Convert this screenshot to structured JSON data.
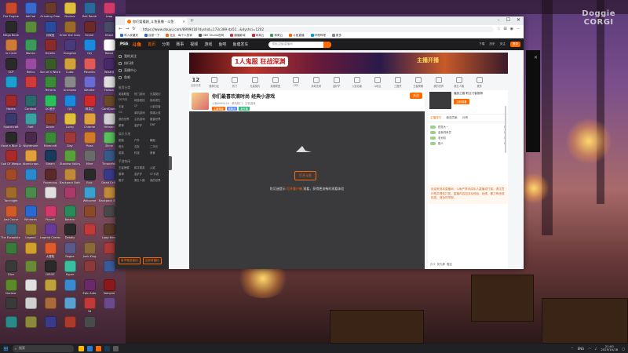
{
  "desktop": {
    "watermark": [
      "Doggie",
      "CORGI"
    ],
    "icons": [
      {
        "label": "Fire Engine",
        "color": "#c84a2a"
      },
      {
        "label": "AdiCad",
        "color": "#3a6ad0"
      },
      {
        "label": "Grinding Gear",
        "color": "#6a3a2a"
      },
      {
        "label": "Duckov",
        "color": "#e0c03a"
      },
      {
        "label": "Rail Route",
        "color": "#2a6a9a"
      },
      {
        "label": "Leap",
        "color": "#d03a6a"
      },
      {
        "label": "Mega Bonk",
        "color": "#2a2a2a"
      },
      {
        "label": "",
        "color": "#5a8a3a"
      },
      {
        "label": "对局宝",
        "color": "#2a4a9a"
      },
      {
        "label": "Enter the Gungeon",
        "color": "#9a6a2a"
      },
      {
        "label": "Sinner",
        "color": "#6a2a2a"
      },
      {
        "label": "Ghost",
        "color": "#4a4a6a"
      },
      {
        "label": "In Circle",
        "color": "#d07a3a"
      },
      {
        "label": "Worms",
        "color": "#3a9a5a"
      },
      {
        "label": "Heretic",
        "color": "#8a2a2a"
      },
      {
        "label": "Dungeon",
        "color": "#4a3a7a"
      },
      {
        "label": "QQ",
        "color": "#1a8ae0"
      },
      {
        "label": "Robot",
        "color": "#ffffff"
      },
      {
        "label": "SCP",
        "color": "#2a2a2a"
      },
      {
        "label": "Relics",
        "color": "#9a4aa0"
      },
      {
        "label": "Son of a Witch",
        "color": "#3a5a2a"
      },
      {
        "label": "Cubic",
        "color": "#d0a03a"
      },
      {
        "label": "Pikuniku",
        "color": "#e05a5a"
      },
      {
        "label": "Wizard",
        "color": "#4a2a6a"
      },
      {
        "label": "",
        "color": "#1aa0d0"
      },
      {
        "label": "",
        "color": "#d03a3a"
      },
      {
        "label": "Terraria",
        "color": "#3a8a3a"
      },
      {
        "label": "Unknown",
        "color": "#888888"
      },
      {
        "label": "Wander",
        "color": "#6a6ad0"
      },
      {
        "label": "Hollow",
        "color": "#e0e0e0"
      },
      {
        "label": "Hades",
        "color": "#a02a2a"
      },
      {
        "label": "Cardinal",
        "color": "#2a6a6a"
      },
      {
        "label": "QQ音乐",
        "color": "#2ac05a"
      },
      {
        "label": "QQ",
        "color": "#1a8ae0"
      },
      {
        "label": "网易云",
        "color": "#d02a2a"
      },
      {
        "label": "CardQuest",
        "color": "#6a4a2a"
      },
      {
        "label": "Spacecraft",
        "color": "#3a3a6a"
      },
      {
        "label": "Raft",
        "color": "#3aa0a0"
      },
      {
        "label": "Doom",
        "color": "#8a3a2a"
      },
      {
        "label": "Lucky",
        "color": "#e0c03a"
      },
      {
        "label": "Chrome",
        "color": "#e0a03a"
      },
      {
        "label": "Hitman",
        "color": "#d0d0d0"
      },
      {
        "label": "Have a Nice Death",
        "color": "#2a2a2a"
      },
      {
        "label": "Nightmare",
        "color": "#4a2a4a"
      },
      {
        "label": "Minecraft",
        "color": "#3a8a3a"
      },
      {
        "label": "Slay",
        "color": "#a03a3a"
      },
      {
        "label": "Pizza",
        "color": "#d07a2a"
      },
      {
        "label": "Slime",
        "color": "#5ac05a"
      },
      {
        "label": "God Of Weapons",
        "color": "#aa2a2a"
      },
      {
        "label": "Atomicrops",
        "color": "#e0a03a"
      },
      {
        "label": "Steam",
        "color": "#1a3a5a"
      },
      {
        "label": "Stardew Valley",
        "color": "#5aa03a"
      },
      {
        "label": "Mine",
        "color": "#6a6a6a"
      },
      {
        "label": "Thronefall",
        "color": "#3a5a8a"
      },
      {
        "label": "",
        "color": "#a04a2a"
      },
      {
        "label": "",
        "color": "#2a8ad0"
      },
      {
        "label": "Ravenous",
        "color": "#5a2a2a"
      },
      {
        "label": "Backpack Battles",
        "color": "#c08a3a"
      },
      {
        "label": "Epic",
        "color": "#2a2a2a"
      },
      {
        "label": "Dead Cells",
        "color": "#3a3a8a"
      },
      {
        "label": "Torchlight",
        "color": "#a06a2a"
      },
      {
        "label": "",
        "color": "#4a8a4a"
      },
      {
        "label": "",
        "color": "#e0e0e0"
      },
      {
        "label": "",
        "color": "#aa3a6a"
      },
      {
        "label": "Welcome",
        "color": "#3aa0d0"
      },
      {
        "label": "Backpack Battles",
        "color": "#c08a3a"
      },
      {
        "label": "Just Cause",
        "color": "#d05a2a"
      },
      {
        "label": "Windows",
        "color": "#2a6ad0"
      },
      {
        "label": "Pinball",
        "color": "#d03a6a"
      },
      {
        "label": "Balatro",
        "color": "#2a8a5a"
      },
      {
        "label": "",
        "color": "#8a4a2a"
      },
      {
        "label": "",
        "color": "#4a4a4a"
      },
      {
        "label": "The Escapists 2",
        "color": "#3a6a8a"
      },
      {
        "label": "Legend",
        "color": "#9a7a2a"
      },
      {
        "label": "Legend Creatures",
        "color": "#6a3a9a"
      },
      {
        "label": "Deadly",
        "color": "#2a2a2a"
      },
      {
        "label": "",
        "color": "#c03a3a"
      },
      {
        "label": "Loop Hero",
        "color": "#5a3a2a"
      },
      {
        "label": "",
        "color": "#3a7a3a"
      },
      {
        "label": "",
        "color": "#d0a02a"
      },
      {
        "label": "大冒险",
        "color": "#e05a2a"
      },
      {
        "label": "Rogue",
        "color": "#5a5a8a"
      },
      {
        "label": "Junk King",
        "color": "#8a6a3a"
      },
      {
        "label": "",
        "color": "#aa3a3a"
      },
      {
        "label": "Dice",
        "color": "#3a3a3a"
      },
      {
        "label": "",
        "color": "#6a8a3a"
      },
      {
        "label": "DIRGE",
        "color": "#2a2a2a"
      },
      {
        "label": "Hyper",
        "color": "#3ac0a0"
      },
      {
        "label": "",
        "color": "#8a3a3a"
      },
      {
        "label": "",
        "color": "#3a5a9a"
      },
      {
        "label": "Nuclear",
        "color": "#5a8a2a"
      },
      {
        "label": "",
        "color": "#e0e0e0"
      },
      {
        "label": "",
        "color": "#c0a03a"
      },
      {
        "label": "",
        "color": "#3a8ad0"
      },
      {
        "label": "Epic Auto",
        "color": "#6a2a6a"
      },
      {
        "label": "Vampire",
        "color": "#8a1a1a"
      },
      {
        "label": "",
        "color": "#3a3a3a"
      },
      {
        "label": "",
        "color": "#d0d0d0"
      },
      {
        "label": "",
        "color": "#aa6a3a"
      },
      {
        "label": "",
        "color": "#5aa0d0"
      },
      {
        "label": "34",
        "color": "#c03a3a"
      },
      {
        "label": "",
        "color": "#6a4a8a"
      },
      {
        "label": "",
        "color": "#2a8a8a"
      },
      {
        "label": "",
        "color": "#8a8a3a"
      },
      {
        "label": "",
        "color": "#3a3a8a"
      },
      {
        "label": "",
        "color": "#aa3a2a"
      },
      {
        "label": "",
        "color": "#4a4a4a"
      }
    ]
  },
  "browser": {
    "tab_title": "你们爱看剧_斗鱼直播 - 斗鱼",
    "url": "https://www.douyu.com/8999416?dyshid=173c389-da51...&dyshci=1202",
    "bookmarks": [
      "导入收藏夹",
      "百度一下",
      "社区 · 每个人的家",
      "OBS Studio官网",
      "播播影城",
      "网易云",
      "奇奇云",
      "斗鱼直播",
      "哔哩哔哩",
      "更多"
    ],
    "nav": [
      "首页",
      "分类",
      "赛事",
      "视频",
      "游戏",
      "鱼吧",
      "鱼塘发车"
    ],
    "search_placeholder": "搜索主播/直播间",
    "header_right": [
      "下载",
      "历史",
      "关注",
      "登录"
    ],
    "sidebar": {
      "items": [
        "我的关注",
        "排行榜",
        "直播中心",
        "鱼吧"
      ],
      "sections": [
        {
          "title": "推荐分类",
          "grid": [
            "英雄联盟",
            "热门游戏",
            "无畏契约",
            "DOTA2",
            "网游竞技",
            "绝地求生",
            "王者",
            "CF",
            "火影忍者",
            "CS",
            "单机游戏",
            "穿越火线",
            "我的世界",
            "主机游戏",
            "魔兽世界",
            "原神",
            "金铲铲",
            "DNF"
          ]
        },
        {
          "title": "娱乐天地",
          "grid": [
            "颜值",
            "户外",
            "舞蹈",
            "音乐",
            "交友",
            "二次元",
            "英雄",
            "科技",
            "美食"
          ]
        },
        {
          "title": "手游休闲",
          "grid": [
            "王者荣耀",
            "和平精英",
            "火影",
            "原神",
            "金铲铲",
            "CF手游",
            "蛋仔",
            "第五人格",
            "我的世界"
          ]
        }
      ],
      "promo": [
        "鱼竿赠送福利",
        "注册领福利"
      ]
    },
    "banner": {
      "left_text": "1人鬼服 狂战深渊",
      "right_text": "主播开播"
    },
    "category_count": {
      "value": "12",
      "label": "全部分类"
    },
    "categories": [
      "推荐分区",
      "热门",
      "无畏契约",
      "英雄联盟",
      "CS2",
      "永劫无间",
      "金铲铲",
      "火影忍者",
      "斗地主",
      "三国杀",
      "王者荣耀",
      "我的世界",
      "第五人格",
      "更多"
    ],
    "room": {
      "title": "你们最喜欢滴时尚 经典小游戏",
      "meta": "斗鱼8999416 · 单机热门 · 主机游戏",
      "tags": [
        {
          "text": "主播等级",
          "style": ""
        },
        {
          "text": "老粉丝",
          "style": "b"
        },
        {
          "text": "新开播",
          "style": "g"
        }
      ],
      "follow_label": "关注",
      "watch_button": "打开斗鱼",
      "tip_prefix": "防沉迷提示",
      "tip_link": "打开客户端",
      "tip_suffix": "观看，获得更流畅的观看体验"
    },
    "right_panel": {
      "top_name": "播放之路·职业门客推荐",
      "top_btn": "立即观看",
      "tabs": [
        "主播排行",
        "最强贡献",
        "月榜"
      ],
      "rank": [
        {
          "name": "视觉大~",
          "value": "0"
        },
        {
          "name": "金鱼饲养员",
          "value": "0"
        },
        {
          "name": "老司机",
          "value": "0"
        },
        {
          "name": "路人",
          "value": "0"
        }
      ],
      "notice": "欢迎来到本直播间，斗鱼严禁未成年人直播或打赏。请注意识别并理性打赏，直播内容如涉及低俗、色情、暴力等违规信息，请及时举报。",
      "gifts": [
        "办卡",
        "荧光棒",
        "赠送"
      ]
    }
  },
  "taskbar": {
    "search": "搜索",
    "tray": [
      "ENG"
    ],
    "time": "21:00",
    "date": "2025/10/18"
  },
  "colors": {
    "accent": "#ff6a00",
    "douyu_dark": "#1d1d1f"
  }
}
